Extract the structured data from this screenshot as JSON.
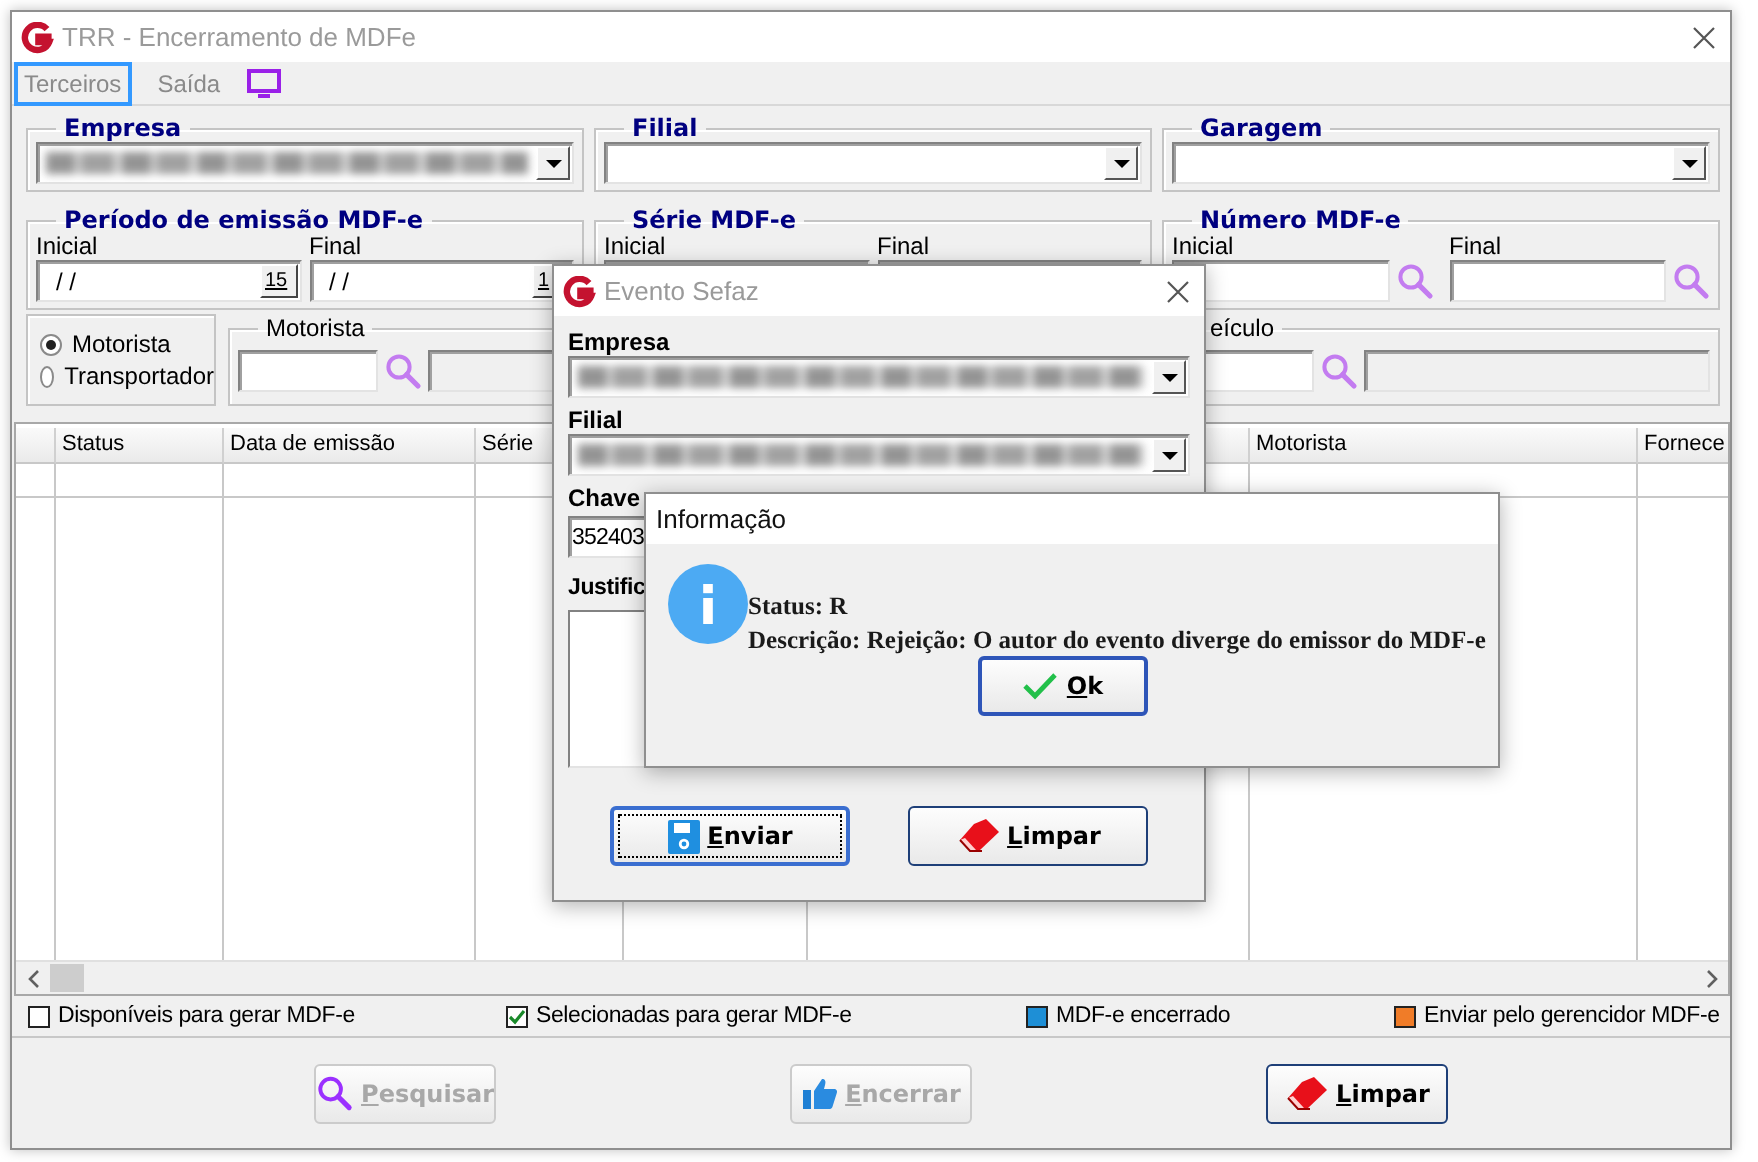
{
  "main_window": {
    "title": "TRR - Encerramento de MDFe",
    "menu": [
      {
        "label": "Terceiros",
        "selected": true
      },
      {
        "label": "Saída",
        "selected": false
      }
    ],
    "empresa": {
      "label": "Empresa",
      "value_blurred": true
    },
    "filial": {
      "label": "Filial",
      "value_blurred": false
    },
    "garagem": {
      "label": "Garagem",
      "value_blurred": false
    },
    "periodo": {
      "label": "Período de emissão MDF-e",
      "fields": [
        {
          "label": "Inicial",
          "value": "/ /",
          "calendar": "15"
        },
        {
          "label": "Final",
          "value": "/ /",
          "calendar": "1"
        }
      ]
    },
    "serie": {
      "label": "Série MDF-e",
      "fields": [
        {
          "label": "Inicial"
        },
        {
          "label": "Final"
        }
      ]
    },
    "numero": {
      "label": "Número MDF-e",
      "fields": [
        {
          "label": "Inicial"
        },
        {
          "label": "Final"
        }
      ]
    },
    "person_type": [
      {
        "label": "Motorista",
        "selected": true
      },
      {
        "label": "Transportador",
        "selected": false
      }
    ],
    "motorista": {
      "label": "Motorista"
    },
    "veiculo": {
      "label": "eículo"
    },
    "table": {
      "columns": [
        {
          "label": "Status"
        },
        {
          "label": "Data de emissão"
        },
        {
          "label": "Série"
        },
        {
          "label": "Motorista"
        },
        {
          "label": "Fornece"
        }
      ]
    },
    "legend": [
      {
        "label": "Disponíveis para gerar MDF-e",
        "color": "#ffffff",
        "checked": false
      },
      {
        "label": "Selecionadas para gerar MDF-e",
        "color": "#ffffff",
        "checked": true
      },
      {
        "label": "MDF-e encerrado",
        "color": "#1e8fd6",
        "checked": false
      },
      {
        "label": "Enviar pelo gerencidor MDF-e",
        "color": "#f07c28",
        "checked": false
      }
    ],
    "buttons": [
      {
        "label": "Pesquisar",
        "kind": "search",
        "disabled": true
      },
      {
        "label": "Encerrar",
        "kind": "thumb",
        "disabled": true
      },
      {
        "label": "Limpar",
        "kind": "eraser",
        "disabled": false
      }
    ]
  },
  "evento_window": {
    "title": "Evento Sefaz",
    "empresa": {
      "label": "Empresa",
      "value_blurred": true
    },
    "filial": {
      "label": "Filial",
      "value_blurred": true
    },
    "chave": {
      "label": "Chave",
      "value": "352403"
    },
    "justificativa": {
      "label": "Justific"
    },
    "buttons": [
      {
        "label": "Enviar",
        "kind": "save",
        "focused": true
      },
      {
        "label": "Limpar",
        "kind": "eraser",
        "focused": false
      }
    ]
  },
  "info_window": {
    "title": "Informação",
    "lines": [
      "Status: R",
      "Descrição: Rejeição: O autor do evento diverge do emissor do MDF-e"
    ],
    "button": {
      "label": "Ok",
      "kind": "check"
    }
  }
}
